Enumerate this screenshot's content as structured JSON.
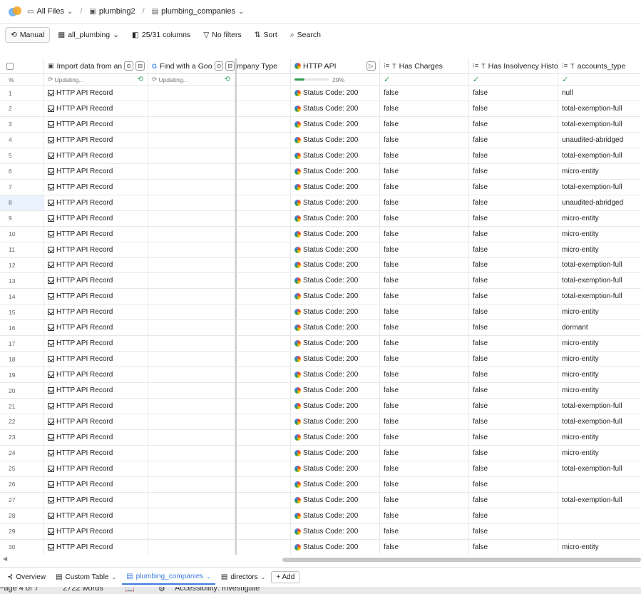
{
  "breadcrumb": {
    "all_files": "All Files",
    "folder": "plumbing2",
    "table": "plumbing_companies"
  },
  "toolbar": {
    "manual": "Manual",
    "view": "all_plumbing",
    "columns": "25/31 columns",
    "filters": "No filters",
    "sort": "Sort",
    "search": "Search"
  },
  "columns": {
    "import": "Import data from an",
    "google": "Find with a Goo",
    "company_type": "mpany Type",
    "http_api": "HTTP API",
    "has_charges": "Has Charges",
    "has_insolvency": "Has Insolvency Histor",
    "accounts_type": "accounts_type"
  },
  "status": {
    "pct_label": "%",
    "updating1": "Updating...",
    "updating2": "Updating...",
    "http_progress": "29%",
    "http_progress_value": 0.29
  },
  "record_label": "HTTP API Record",
  "status_code": "Status Code: 200",
  "rows": [
    {
      "n": "1",
      "charges": "false",
      "insolvency": "false",
      "accounts": "null"
    },
    {
      "n": "2",
      "charges": "false",
      "insolvency": "false",
      "accounts": "total-exemption-full"
    },
    {
      "n": "3",
      "charges": "false",
      "insolvency": "false",
      "accounts": "total-exemption-full"
    },
    {
      "n": "4",
      "charges": "false",
      "insolvency": "false",
      "accounts": "unaudited-abridged"
    },
    {
      "n": "5",
      "charges": "false",
      "insolvency": "false",
      "accounts": "total-exemption-full"
    },
    {
      "n": "6",
      "charges": "false",
      "insolvency": "false",
      "accounts": "micro-entity"
    },
    {
      "n": "7",
      "charges": "false",
      "insolvency": "false",
      "accounts": "total-exemption-full"
    },
    {
      "n": "8",
      "charges": "false",
      "insolvency": "false",
      "accounts": "unaudited-abridged"
    },
    {
      "n": "9",
      "charges": "false",
      "insolvency": "false",
      "accounts": "micro-entity"
    },
    {
      "n": "10",
      "charges": "false",
      "insolvency": "false",
      "accounts": "micro-entity"
    },
    {
      "n": "11",
      "charges": "false",
      "insolvency": "false",
      "accounts": "micro-entity"
    },
    {
      "n": "12",
      "charges": "false",
      "insolvency": "false",
      "accounts": "total-exemption-full"
    },
    {
      "n": "13",
      "charges": "false",
      "insolvency": "false",
      "accounts": "total-exemption-full"
    },
    {
      "n": "14",
      "charges": "false",
      "insolvency": "false",
      "accounts": "total-exemption-full"
    },
    {
      "n": "15",
      "charges": "false",
      "insolvency": "false",
      "accounts": "micro-entity"
    },
    {
      "n": "16",
      "charges": "false",
      "insolvency": "false",
      "accounts": "dormant"
    },
    {
      "n": "17",
      "charges": "false",
      "insolvency": "false",
      "accounts": "micro-entity"
    },
    {
      "n": "18",
      "charges": "false",
      "insolvency": "false",
      "accounts": "micro-entity"
    },
    {
      "n": "19",
      "charges": "false",
      "insolvency": "false",
      "accounts": "micro-entity"
    },
    {
      "n": "20",
      "charges": "false",
      "insolvency": "false",
      "accounts": "micro-entity"
    },
    {
      "n": "21",
      "charges": "false",
      "insolvency": "false",
      "accounts": "total-exemption-full"
    },
    {
      "n": "22",
      "charges": "false",
      "insolvency": "false",
      "accounts": "total-exemption-full"
    },
    {
      "n": "23",
      "charges": "false",
      "insolvency": "false",
      "accounts": "micro-entity"
    },
    {
      "n": "24",
      "charges": "false",
      "insolvency": "false",
      "accounts": "micro-entity"
    },
    {
      "n": "25",
      "charges": "false",
      "insolvency": "false",
      "accounts": "total-exemption-full"
    },
    {
      "n": "26",
      "charges": "false",
      "insolvency": "false",
      "accounts": ""
    },
    {
      "n": "27",
      "charges": "false",
      "insolvency": "false",
      "accounts": "total-exemption-full"
    },
    {
      "n": "28",
      "charges": "false",
      "insolvency": "false",
      "accounts": ""
    },
    {
      "n": "29",
      "charges": "false",
      "insolvency": "false",
      "accounts": ""
    },
    {
      "n": "30",
      "charges": "false",
      "insolvency": "false",
      "accounts": "micro-entity"
    }
  ],
  "tabs": {
    "overview": "Overview",
    "custom_table": "Custom Table",
    "plumbing": "plumbing_companies",
    "directors": "directors",
    "add": "+ Add"
  },
  "footer": {
    "page": "Page 4 of 7",
    "words": "2722 words",
    "accessibility": "Accessibility: Investigate"
  },
  "colors": {
    "accent": "#3b7ddd",
    "check": "#2e9e4f"
  }
}
